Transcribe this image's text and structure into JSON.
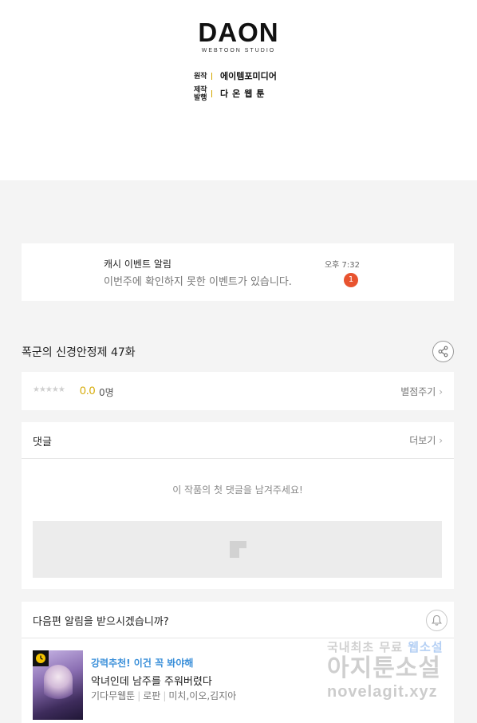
{
  "credits": {
    "logo_main": "DAON",
    "logo_sub": "WEBTOON STUDIO",
    "original_label": "원작",
    "original_value": "에이템포미디어",
    "produce_label_1": "제작",
    "produce_label_2": "발행",
    "produce_value": "다온웹툰",
    "accent_color": "#d4a800"
  },
  "notification": {
    "title": "캐시 이벤트 알림",
    "body": "이번주에 확인하지 못한 이벤트가 있습니다.",
    "time": "오후 7:32",
    "badge_count": "1",
    "badge_color": "#e8532f"
  },
  "episode": {
    "title": "폭군의 신경안정제 47화",
    "share_icon": "share-icon"
  },
  "rating": {
    "stars": "★★★★★",
    "score": "0.0",
    "count": "0명",
    "rate_link": "별점주기"
  },
  "comments": {
    "title": "댓글",
    "more": "더보기",
    "empty_message": "이 작품의 첫 댓글을 남겨주세요!"
  },
  "next_episode": {
    "prompt": "다음편 알림을 받으시겠습니까?",
    "bell_icon": "bell-icon"
  },
  "recommendation": {
    "tag": "강력추천! 이건 꼭 봐야해",
    "title": "악녀인데 남주를 주워버렸다",
    "meta": [
      "기다무웹툰",
      "로판",
      "미치,이오,김지아"
    ],
    "tag_color": "#3a8fd9"
  },
  "watermark": {
    "line1_prefix": "국내최초 무료 ",
    "line1_accent": "웹소설",
    "line2": "아지툰소설",
    "line3": "novelagit.xyz"
  }
}
